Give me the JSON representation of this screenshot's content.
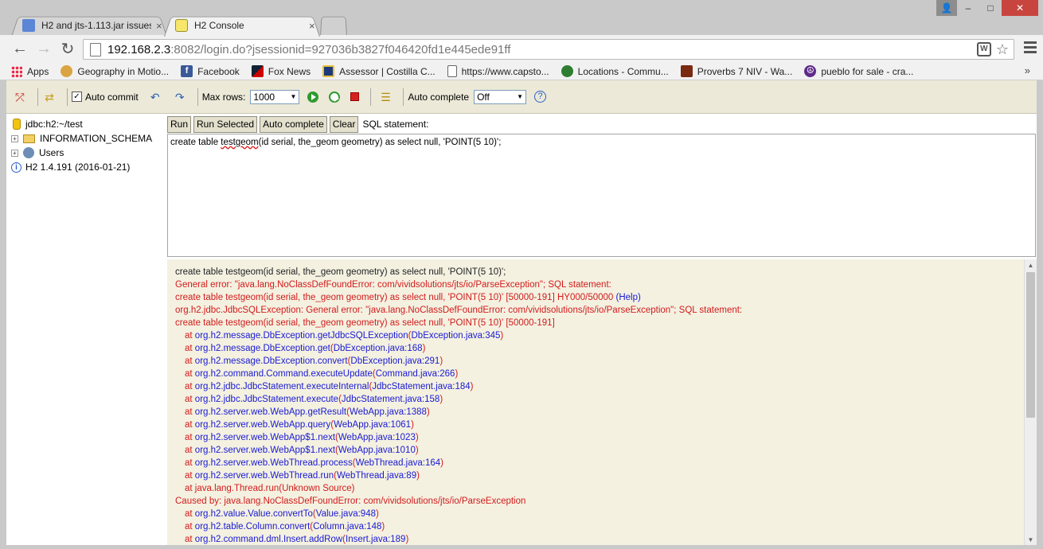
{
  "browser": {
    "tabs": [
      {
        "title": "H2 and jts-1.113.jar issues",
        "close": "×"
      },
      {
        "title": "H2 Console",
        "close": "×"
      }
    ],
    "url_host": "192.168.2.3",
    "url_rest": ":8082/login.do?jsessionid=927036b3827f046420fd1e445ede91ff",
    "window_buttons": {
      "minimize": "–",
      "maximize": "□",
      "close": "✕"
    },
    "bookmarks": [
      {
        "label": "Apps"
      },
      {
        "label": "Geography in Motio..."
      },
      {
        "label": "Facebook"
      },
      {
        "label": "Fox News"
      },
      {
        "label": "Assessor | Costilla C..."
      },
      {
        "label": "https://www.capsto..."
      },
      {
        "label": "Locations - Commu..."
      },
      {
        "label": "Proverbs 7 NIV - Wa..."
      },
      {
        "label": "pueblo for sale - cra..."
      }
    ],
    "bookmarks_more": "»"
  },
  "h2_toolbar": {
    "auto_commit_label": "Auto commit",
    "max_rows_label": "Max rows:",
    "max_rows_value": "1000",
    "auto_complete_label": "Auto complete",
    "auto_complete_value": "Off",
    "help": "?"
  },
  "tree": {
    "connection": "jdbc:h2:~/test",
    "schema": "INFORMATION_SCHEMA",
    "users": "Users",
    "version": "H2 1.4.191 (2016-01-21)"
  },
  "query": {
    "buttons": {
      "run": "Run",
      "run_selected": "Run Selected",
      "auto_complete": "Auto complete",
      "clear": "Clear"
    },
    "sql_label": "SQL statement:",
    "sql_before": "create table ",
    "sql_squiggly": "testgeom",
    "sql_after": "(id serial, the_geom geometry) as select null, 'POINT(5 10)';"
  },
  "result": {
    "lines": [
      {
        "text": "create table testgeom(id serial, the_geom geometry) as select null, 'POINT(5 10)';",
        "style": "black"
      },
      {
        "text": "General error: \"java.lang.NoClassDefFoundError: com/vividsolutions/jts/io/ParseException\"; SQL statement:",
        "style": "red"
      },
      {
        "text": "create table testgeom(id serial, the_geom geometry) as select null, 'POINT(5 10)' [50000-191] HY000/50000 ",
        "link": "(Help)",
        "style": "red"
      },
      {
        "text": "org.h2.jdbc.JdbcSQLException: General error: \"java.lang.NoClassDefFoundError: com/vividsolutions/jts/io/ParseException\"; SQL statement:",
        "style": "red"
      },
      {
        "text": "create table testgeom(id serial, the_geom geometry) as select null, 'POINT(5 10)' [50000-191]",
        "style": "red"
      },
      {
        "text": "at ",
        "method": "org.h2.message.DbException.getJdbcSQLException",
        "src": "DbException.java:345",
        "style": "trace"
      },
      {
        "text": "at ",
        "method": "org.h2.message.DbException.get",
        "src": "DbException.java:168",
        "style": "trace"
      },
      {
        "text": "at ",
        "method": "org.h2.message.DbException.convert",
        "src": "DbException.java:291",
        "style": "trace"
      },
      {
        "text": "at ",
        "method": "org.h2.command.Command.executeUpdate",
        "src": "Command.java:266",
        "style": "trace"
      },
      {
        "text": "at ",
        "method": "org.h2.jdbc.JdbcStatement.executeInternal",
        "src": "JdbcStatement.java:184",
        "style": "trace"
      },
      {
        "text": "at ",
        "method": "org.h2.jdbc.JdbcStatement.execute",
        "src": "JdbcStatement.java:158",
        "style": "trace"
      },
      {
        "text": "at ",
        "method": "org.h2.server.web.WebApp.getResult",
        "src": "WebApp.java:1388",
        "style": "trace"
      },
      {
        "text": "at ",
        "method": "org.h2.server.web.WebApp.query",
        "src": "WebApp.java:1061",
        "style": "trace"
      },
      {
        "text": "at ",
        "method": "org.h2.server.web.WebApp$1.next",
        "src": "WebApp.java:1023",
        "style": "trace"
      },
      {
        "text": "at ",
        "method": "org.h2.server.web.WebApp$1.next",
        "src": "WebApp.java:1010",
        "style": "trace"
      },
      {
        "text": "at ",
        "method": "org.h2.server.web.WebThread.process",
        "src": "WebThread.java:164",
        "style": "trace"
      },
      {
        "text": "at ",
        "method": "org.h2.server.web.WebThread.run",
        "src": "WebThread.java:89",
        "style": "trace"
      },
      {
        "text": "at java.lang.Thread.run(Unknown Source)",
        "style": "indent-red"
      },
      {
        "text": "Caused by: java.lang.NoClassDefFoundError: com/vividsolutions/jts/io/ParseException",
        "style": "red"
      },
      {
        "text": "at ",
        "method": "org.h2.value.Value.convertTo",
        "src": "Value.java:948",
        "style": "trace"
      },
      {
        "text": "at ",
        "method": "org.h2.table.Column.convert",
        "src": "Column.java:148",
        "style": "trace"
      },
      {
        "text": "at ",
        "method": "org.h2.command.dml.Insert.addRow",
        "src": "Insert.java:189",
        "style": "trace"
      }
    ]
  }
}
